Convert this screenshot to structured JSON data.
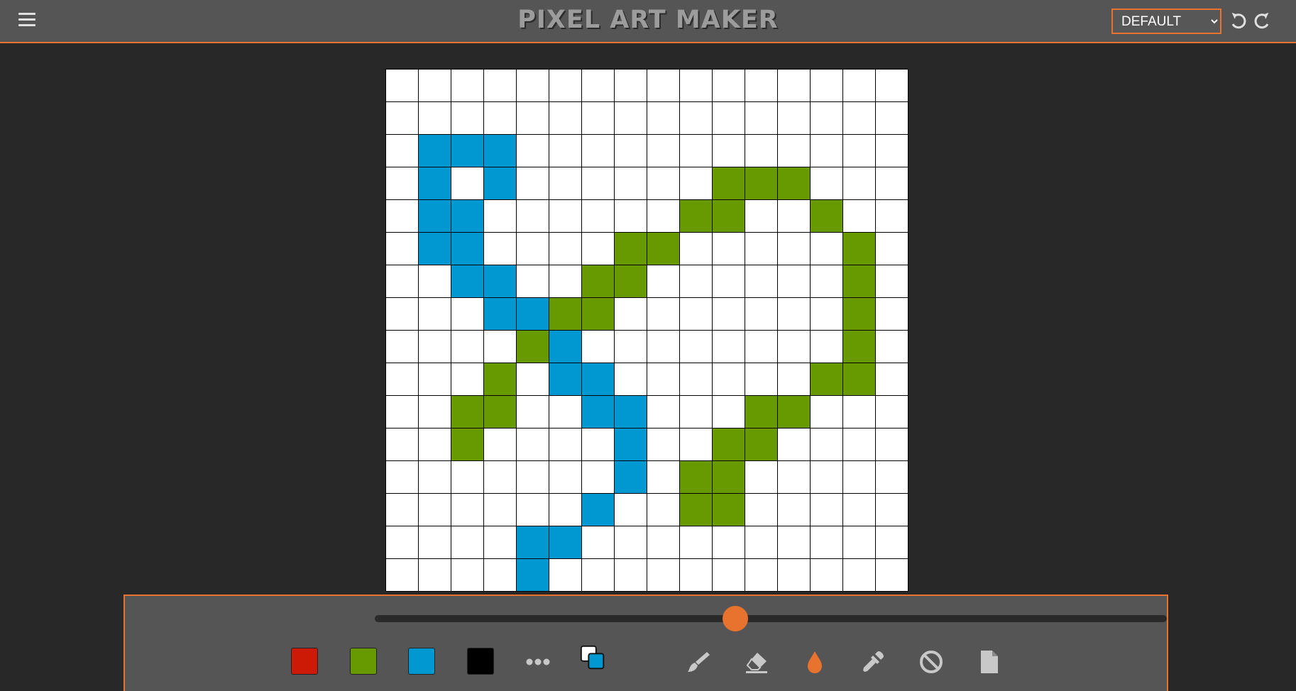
{
  "header": {
    "title": "PIXEL ART MAKER",
    "preset_selected": "DEFAULT",
    "preset_options": [
      "DEFAULT"
    ]
  },
  "canvas": {
    "rows": 16,
    "cols": 16,
    "palette": {
      "W": "#ffffff",
      "B": "#0197d0",
      "G": "#679a00"
    },
    "grid": [
      "WWWWWWWWWWWWWWWW",
      "WWWWWWWWWWWWWWWW",
      "WBBBWWWWWWWWWWWW",
      "WBWBWWWWWWGGGWWW",
      "WBBWWWWWWGGWWGWW",
      "WBBWWWWGGWWWWWGW",
      "WWBBWWGGWWWWWWGW",
      "WWWBBGGWWWWWWWGW",
      "WWWWGBWWWWWWWWGW",
      "WWWGWBBWWWWWWGGW",
      "WWGGWWBBWWWGGWWW",
      "WWGWWWWBWWGGWWWW",
      "WWWWWWWBWGGWWWWW",
      "WWWWWWBWWGGWWWWW",
      "WWWWBBWWWWWWWWWW",
      "WWWWBWWWWWWWWWWW"
    ]
  },
  "toolbar": {
    "brush_size_fraction": 0.455,
    "swatches": [
      {
        "name": "red",
        "color": "#cc1a06"
      },
      {
        "name": "green",
        "color": "#679a00"
      },
      {
        "name": "blue",
        "color": "#0197d0"
      },
      {
        "name": "black",
        "color": "#000000"
      }
    ],
    "more_colors_icon": "more-dots-icon",
    "swap_colors_icon": "swap-colors-icon",
    "current_primary": "#ffffff",
    "current_secondary": "#0197d0",
    "tools": [
      "brush-icon",
      "eraser-icon",
      "fill-bucket-icon",
      "eyedropper-icon",
      "clear-icon",
      "new-file-icon"
    ],
    "accent": "#e8732f"
  }
}
